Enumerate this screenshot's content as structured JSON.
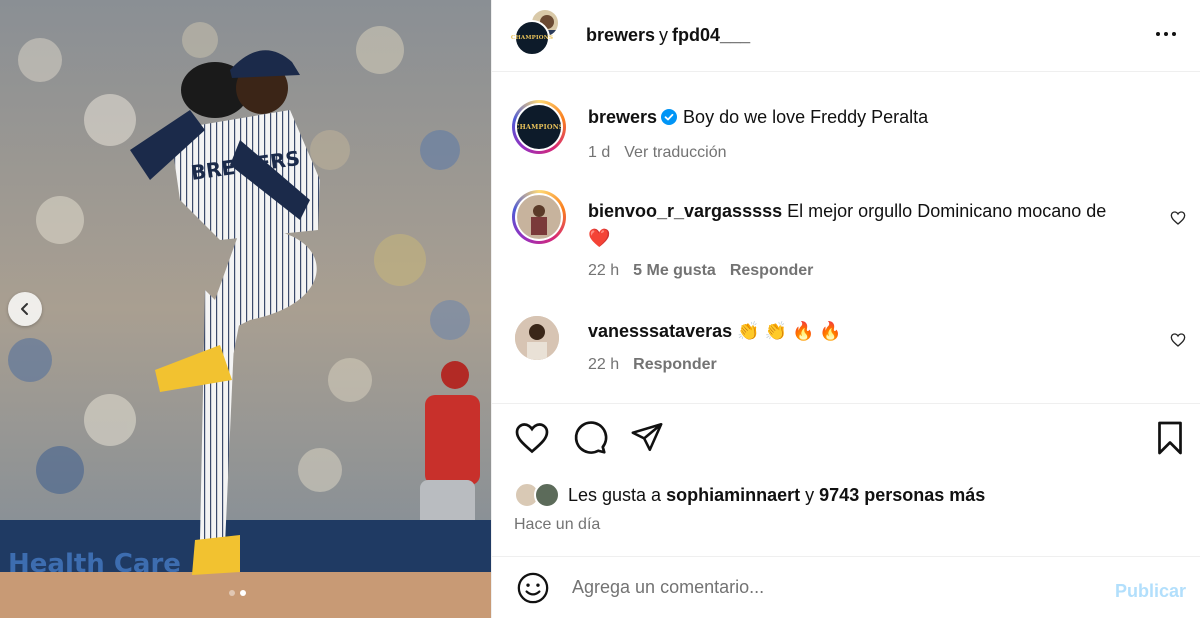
{
  "header": {
    "user1": "brewers",
    "conjunction": "y",
    "user2": "fpd04___",
    "avatar_badge_text": "CHAMPIONS",
    "more_icon": "more-horizontal-icon"
  },
  "caption": {
    "username": "brewers",
    "verified_icon": "verified-badge-icon",
    "text": "Boy do we love Freddy Peralta",
    "time": "1 d",
    "translate": "Ver traducción"
  },
  "comments": [
    {
      "username": "bienvoo_r_vargasssss",
      "text": "El mejor orgullo Dominicano mocano de",
      "emoji": "❤️",
      "time": "22 h",
      "likes": "5 Me gusta",
      "reply": "Responder"
    },
    {
      "username": "vanesssataveras",
      "emoji": "👏 👏 🔥 🔥",
      "time": "22 h",
      "reply": "Responder"
    }
  ],
  "likes": {
    "prefix": "Les gusta a",
    "user": "sophiaminnaert",
    "connector": "y",
    "others": "9743 personas más"
  },
  "post_time": "Hace un día",
  "add_comment": {
    "placeholder": "Agrega un comentario...",
    "publish": "Publicar"
  },
  "media": {
    "jersey_text": "BREWERS",
    "banner_text": "Health Care",
    "carousel_count": 2,
    "carousel_active": 2
  },
  "colors": {
    "verified": "#0095f6",
    "publish_disabled": "#b2dffc",
    "muted_text": "#737373",
    "heart_red": "#ed4956"
  }
}
